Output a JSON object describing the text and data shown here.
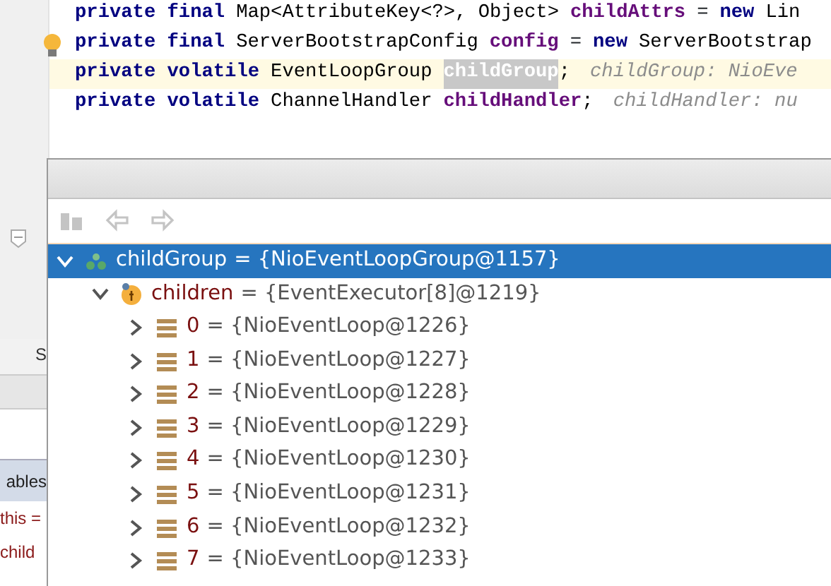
{
  "editor": {
    "lines": [
      {
        "current": false,
        "bulb": false,
        "tokens": [
          {
            "kind": "keyword",
            "text": "private final"
          },
          {
            "kind": "type",
            "text": "Map<AttributeKey<?>, Object>"
          },
          {
            "kind": "field",
            "text": "childAttrs"
          },
          {
            "kind": "plain",
            "text": "="
          },
          {
            "kind": "keyword",
            "text": "new"
          },
          {
            "kind": "type",
            "text": "Lin"
          }
        ]
      },
      {
        "current": false,
        "bulb": true,
        "tokens": [
          {
            "kind": "keyword",
            "text": "private final"
          },
          {
            "kind": "type",
            "text": "ServerBootstrapConfig"
          },
          {
            "kind": "field",
            "text": "config"
          },
          {
            "kind": "plain",
            "text": "="
          },
          {
            "kind": "keyword",
            "text": "new"
          },
          {
            "kind": "type",
            "text": "ServerBootstrap"
          }
        ]
      },
      {
        "current": true,
        "bulb": false,
        "tokens": [
          {
            "kind": "keyword",
            "text": "private volatile"
          },
          {
            "kind": "type",
            "text": "EventLoopGroup"
          },
          {
            "kind": "selected-field",
            "text": "childGroup"
          },
          {
            "kind": "punct",
            "text": ";"
          },
          {
            "kind": "hint",
            "text": "childGroup: NioEve"
          }
        ]
      },
      {
        "current": false,
        "bulb": false,
        "tokens": [
          {
            "kind": "keyword",
            "text": "private volatile"
          },
          {
            "kind": "type",
            "text": "ChannelHandler"
          },
          {
            "kind": "field",
            "text": "childHandler"
          },
          {
            "kind": "punct",
            "text": ";"
          },
          {
            "kind": "hint",
            "text": "childHandler: nu"
          }
        ]
      }
    ]
  },
  "side_panel": {
    "tab": "S",
    "header": "ables",
    "rows": [
      "this =",
      "child"
    ]
  },
  "popup": {
    "toolbar": [
      {
        "kind": "layout",
        "disabled": true
      },
      {
        "kind": "back",
        "disabled": true
      },
      {
        "kind": "forward",
        "disabled": true
      }
    ],
    "tree": [
      {
        "kind": "group",
        "name": "childGroup",
        "value": "= {NioEventLoopGroup@1157}",
        "expanded": true,
        "selected": true,
        "children": [
          {
            "kind": "field",
            "name": "children",
            "value": "= {EventExecutor[8]@1219}",
            "expanded": true,
            "selected": false,
            "children": [
              {
                "kind": "array",
                "name": "0",
                "value": "= {NioEventLoop@1226}",
                "expanded": false,
                "selected": false
              },
              {
                "kind": "array",
                "name": "1",
                "value": "= {NioEventLoop@1227}",
                "expanded": false,
                "selected": false
              },
              {
                "kind": "array",
                "name": "2",
                "value": "= {NioEventLoop@1228}",
                "expanded": false,
                "selected": false
              },
              {
                "kind": "array",
                "name": "3",
                "value": "= {NioEventLoop@1229}",
                "expanded": false,
                "selected": false
              },
              {
                "kind": "array",
                "name": "4",
                "value": "= {NioEventLoop@1230}",
                "expanded": false,
                "selected": false
              },
              {
                "kind": "array",
                "name": "5",
                "value": "= {NioEventLoop@1231}",
                "expanded": false,
                "selected": false
              },
              {
                "kind": "array",
                "name": "6",
                "value": "= {NioEventLoop@1232}",
                "expanded": false,
                "selected": false
              },
              {
                "kind": "array",
                "name": "7",
                "value": "= {NioEventLoop@1233}",
                "expanded": false,
                "selected": false
              }
            ]
          }
        ]
      }
    ]
  }
}
